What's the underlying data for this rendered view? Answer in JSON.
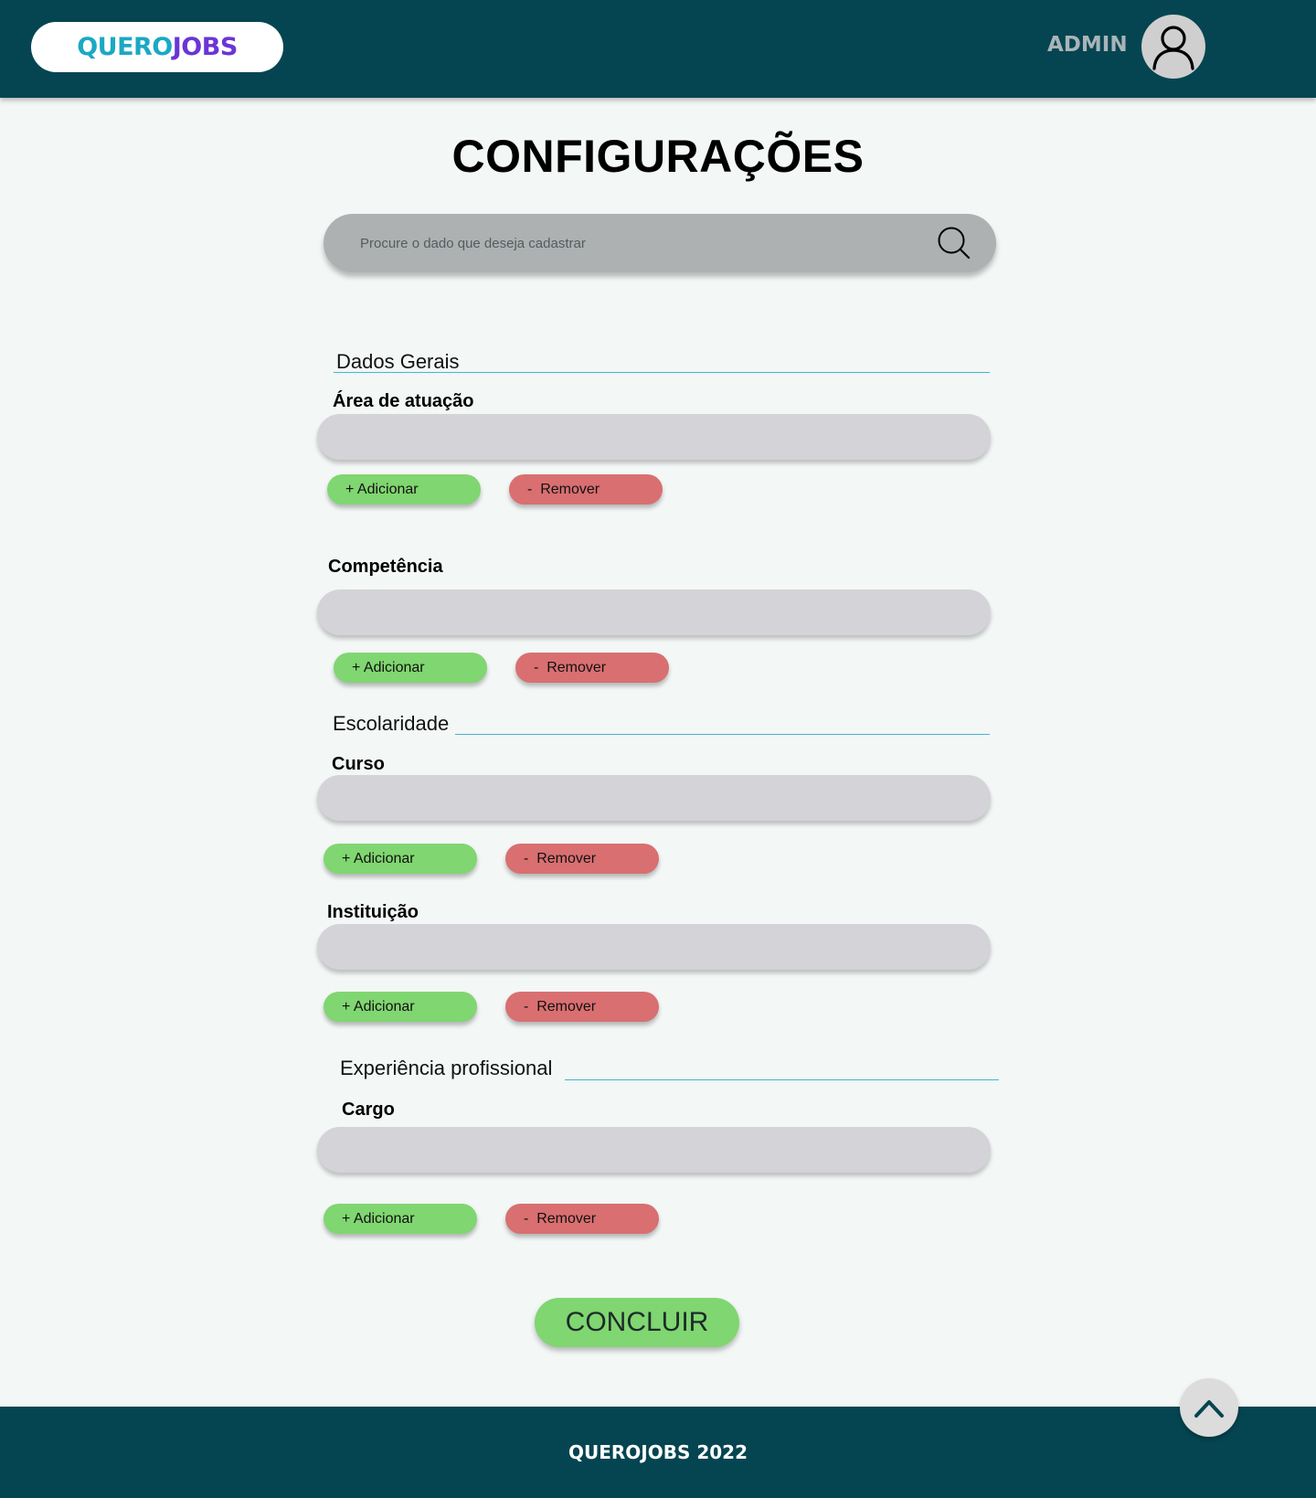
{
  "header": {
    "logo_part1": "QUERO",
    "logo_part2": "JOBS",
    "user_label": "ADMIN",
    "avatar_icon": "user-icon"
  },
  "page": {
    "title": "CONFIGURAÇÕES"
  },
  "search": {
    "placeholder": "Procure o dado que deseja cadastrar",
    "value": "",
    "icon": "search-icon"
  },
  "sections": {
    "general": {
      "title": "Dados Gerais",
      "fields": {
        "area": {
          "label": "Área de atuação",
          "value": ""
        },
        "competencia": {
          "label": "Competência",
          "value": ""
        }
      }
    },
    "education": {
      "title": "Escolaridade",
      "fields": {
        "curso": {
          "label": "Curso",
          "value": ""
        },
        "instituicao": {
          "label": "Instituição",
          "value": ""
        }
      }
    },
    "experience": {
      "title": "Experiência profissional",
      "fields": {
        "cargo": {
          "label": "Cargo",
          "value": ""
        }
      }
    }
  },
  "actions": {
    "add_label": "+ Adicionar",
    "remove_label": "-  Remover",
    "submit_label": "CONCLUIR"
  },
  "footer": {
    "text": "QUEROJOBS 2022",
    "back_to_top_icon": "chevron-up-icon"
  },
  "colors": {
    "header_bg": "#054551",
    "add_button": "#80d670",
    "remove_button": "#d96f70",
    "accent_line": "#43b6cf",
    "logo_cyan": "#1ba8c4",
    "logo_purple": "#6a35d6"
  }
}
